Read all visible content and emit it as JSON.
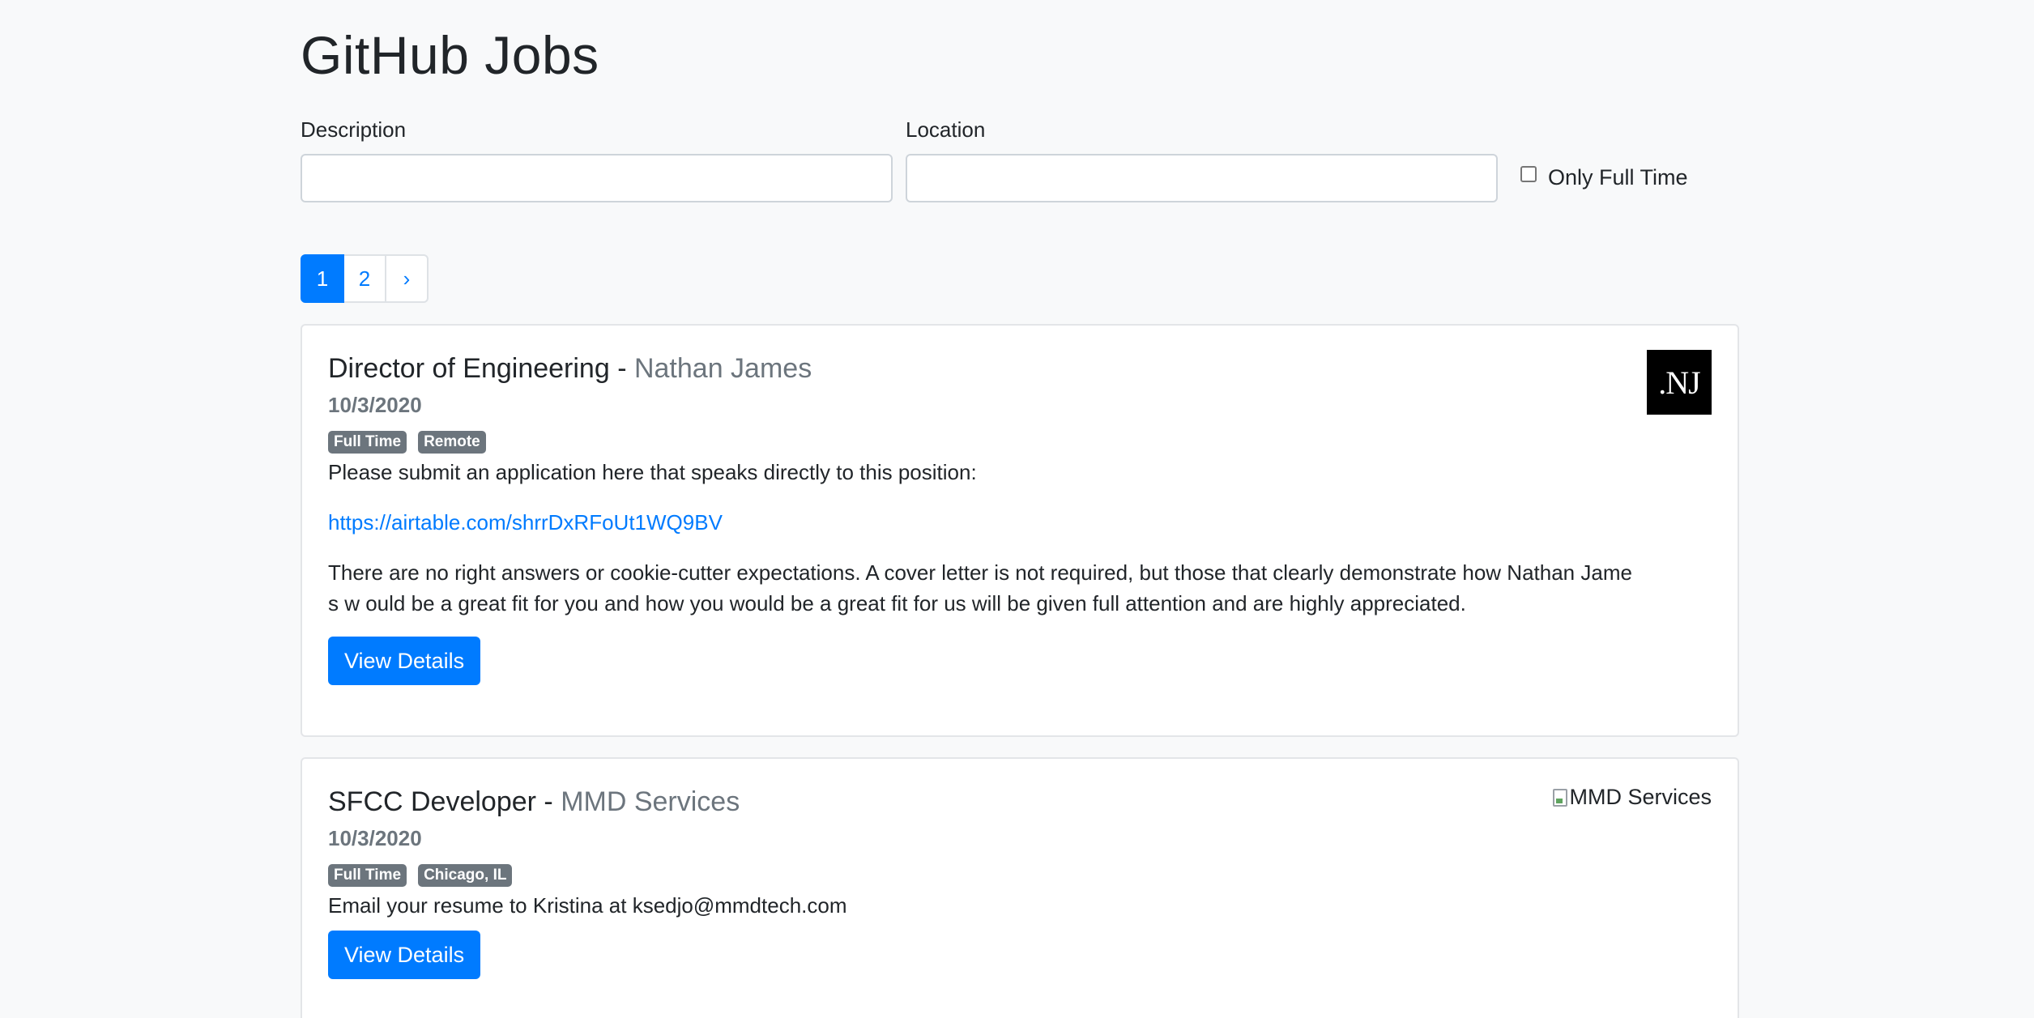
{
  "header": {
    "title": "GitHub Jobs"
  },
  "search": {
    "description_label": "Description",
    "description_value": "",
    "location_label": "Location",
    "location_value": "",
    "full_time_label": "Only Full Time",
    "full_time_checked": false
  },
  "pagination": {
    "pages": [
      "1",
      "2"
    ],
    "next": "›",
    "active_page": "1"
  },
  "jobs": [
    {
      "title": "Director of Engineering",
      "separator": " - ",
      "company": "Nathan James",
      "date": "10/3/2020",
      "badges": [
        "Full Time",
        "Remote"
      ],
      "logo_text": ".NJ",
      "desc_line1": "Please submit an application here that speaks directly to this position:",
      "desc_link": "https://airtable.com/shrrDxRFoUt1WQ9BV",
      "desc_line2": "There are no right answers or cookie-cutter expectations. A cover letter is not required, but those that clearly demonstrate how Nathan James w ould be a great fit for you and how you would be a great fit for us will be given full attention and are highly appreciated.",
      "button": "View Details"
    },
    {
      "title": "SFCC Developer",
      "separator": " - ",
      "company": "MMD Services",
      "date": "10/3/2020",
      "badges": [
        "Full Time",
        "Chicago, IL"
      ],
      "logo_alt": "MMD Services",
      "desc_line1": "Email your resume to Kristina at ksedjo@mmdtech.com",
      "button": "View Details"
    }
  ],
  "colors": {
    "primary": "#007bff",
    "badge": "#6c757d",
    "background": "#f8f9fa"
  }
}
